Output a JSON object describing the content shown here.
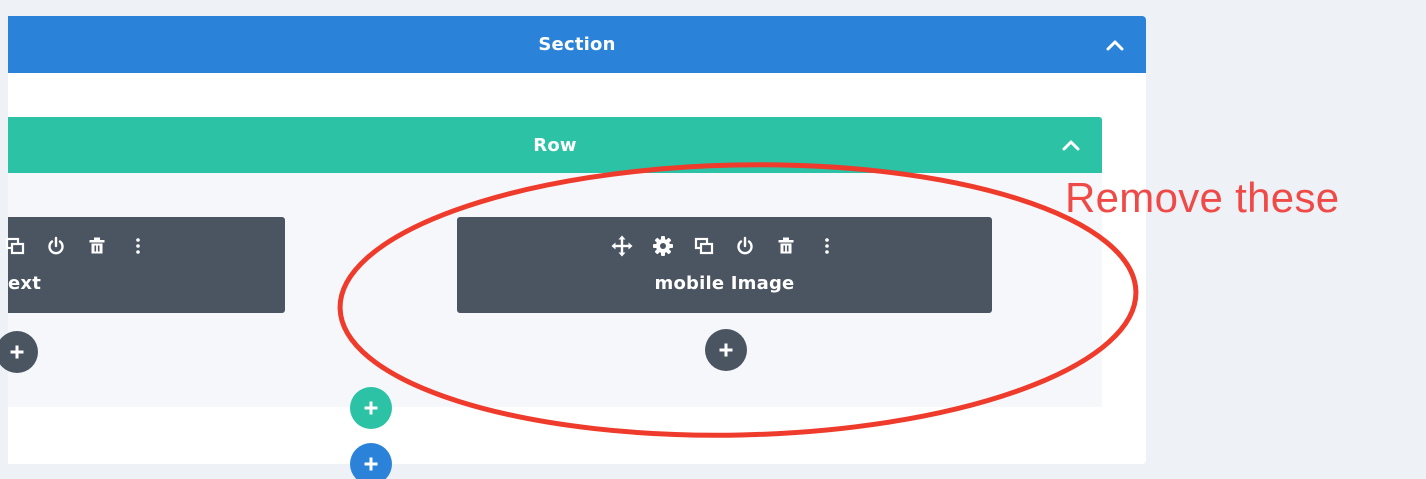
{
  "section": {
    "title": "Section",
    "bar_color": "#2a83d8",
    "collapse_icon": "chevron-up-icon"
  },
  "row": {
    "title": "Row",
    "bar_color": "#2bc2a6",
    "collapse_icon": "chevron-up-icon"
  },
  "modules": [
    {
      "label": "ext",
      "tools": [
        "duplicate-icon",
        "power-icon",
        "trash-icon",
        "more-icon"
      ]
    },
    {
      "label": "mobile Image",
      "tools": [
        "move-icon",
        "settings-icon",
        "duplicate-icon",
        "power-icon",
        "trash-icon",
        "more-icon"
      ]
    }
  ],
  "add_buttons": {
    "module": "plus-icon",
    "row": "plus-icon",
    "section": "plus-icon"
  },
  "annotation": {
    "text": "Remove these",
    "color": "#ef4a48"
  },
  "colors": {
    "module_bg": "#4a5561",
    "page_bg": "#eef1f6"
  }
}
